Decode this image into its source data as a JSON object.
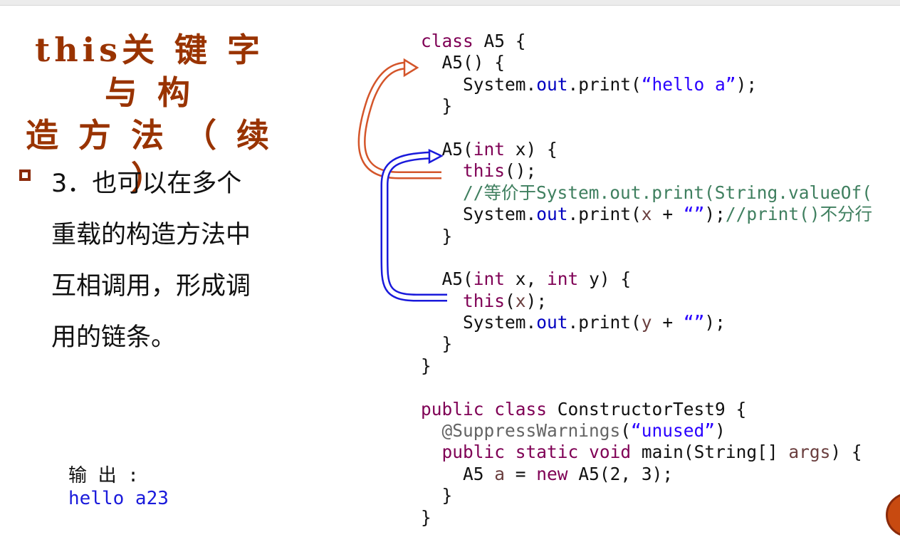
{
  "slide": {
    "title": "this关 键 字与 构\n造 方 法 （ 续 ）",
    "bullet_text": "3．也可以在多个\n重载的构造方法中\n互相调用，形成调\n用的链条。",
    "output_label": "输 出 :",
    "output_value": "hello a23"
  },
  "code_lines": [
    [
      {
        "t": "class",
        "c": "keyword"
      },
      {
        "t": " A5 {",
        "c": "plain"
      }
    ],
    [
      {
        "t": "  A5() {",
        "c": "plain"
      }
    ],
    [
      {
        "t": "    System.",
        "c": "plain"
      },
      {
        "t": "out",
        "c": "field"
      },
      {
        "t": ".print(",
        "c": "plain"
      },
      {
        "t": "“hello a”",
        "c": "string"
      },
      {
        "t": ");",
        "c": "plain"
      }
    ],
    [
      {
        "t": "  }",
        "c": "plain"
      }
    ],
    [
      {
        "t": "",
        "c": "plain"
      }
    ],
    [
      {
        "t": "  A5(",
        "c": "plain"
      },
      {
        "t": "int",
        "c": "keyword"
      },
      {
        "t": " x) {",
        "c": "plain"
      }
    ],
    [
      {
        "t": "    ",
        "c": "plain"
      },
      {
        "t": "this",
        "c": "keyword"
      },
      {
        "t": "();",
        "c": "plain"
      }
    ],
    [
      {
        "t": "    //等价于System.out.print(String.valueOf(",
        "c": "comment"
      }
    ],
    [
      {
        "t": "    System.",
        "c": "plain"
      },
      {
        "t": "out",
        "c": "field"
      },
      {
        "t": ".print(",
        "c": "plain"
      },
      {
        "t": "x",
        "c": "variable"
      },
      {
        "t": " + ",
        "c": "plain"
      },
      {
        "t": "“”",
        "c": "string"
      },
      {
        "t": ");",
        "c": "plain"
      },
      {
        "t": "//print()不分行",
        "c": "comment"
      }
    ],
    [
      {
        "t": "  }",
        "c": "plain"
      }
    ],
    [
      {
        "t": "",
        "c": "plain"
      }
    ],
    [
      {
        "t": "  A5(",
        "c": "plain"
      },
      {
        "t": "int",
        "c": "keyword"
      },
      {
        "t": " x, ",
        "c": "plain"
      },
      {
        "t": "int",
        "c": "keyword"
      },
      {
        "t": " y) {",
        "c": "plain"
      }
    ],
    [
      {
        "t": "    ",
        "c": "plain"
      },
      {
        "t": "this",
        "c": "keyword"
      },
      {
        "t": "(",
        "c": "plain"
      },
      {
        "t": "x",
        "c": "variable"
      },
      {
        "t": ");",
        "c": "plain"
      }
    ],
    [
      {
        "t": "    System.",
        "c": "plain"
      },
      {
        "t": "out",
        "c": "field"
      },
      {
        "t": ".print(",
        "c": "plain"
      },
      {
        "t": "y",
        "c": "variable"
      },
      {
        "t": " + ",
        "c": "plain"
      },
      {
        "t": "“”",
        "c": "string"
      },
      {
        "t": ");",
        "c": "plain"
      }
    ],
    [
      {
        "t": "  }",
        "c": "plain"
      }
    ],
    [
      {
        "t": "}",
        "c": "plain"
      }
    ],
    [
      {
        "t": "",
        "c": "plain"
      }
    ],
    [
      {
        "t": "public",
        "c": "keyword"
      },
      {
        "t": " ",
        "c": "plain"
      },
      {
        "t": "class",
        "c": "keyword"
      },
      {
        "t": " ConstructorTest9 {",
        "c": "plain"
      }
    ],
    [
      {
        "t": "  ",
        "c": "plain"
      },
      {
        "t": "@SuppressWarnings",
        "c": "annotation"
      },
      {
        "t": "(",
        "c": "plain"
      },
      {
        "t": "“unused”",
        "c": "string"
      },
      {
        "t": ")",
        "c": "plain"
      }
    ],
    [
      {
        "t": "  ",
        "c": "plain"
      },
      {
        "t": "public",
        "c": "keyword"
      },
      {
        "t": " ",
        "c": "plain"
      },
      {
        "t": "static",
        "c": "keyword"
      },
      {
        "t": " ",
        "c": "plain"
      },
      {
        "t": "void",
        "c": "keyword"
      },
      {
        "t": " main(String[] ",
        "c": "plain"
      },
      {
        "t": "args",
        "c": "variable"
      },
      {
        "t": ") {",
        "c": "plain"
      }
    ],
    [
      {
        "t": "    A5 ",
        "c": "plain"
      },
      {
        "t": "a",
        "c": "variable"
      },
      {
        "t": " = ",
        "c": "plain"
      },
      {
        "t": "new",
        "c": "keyword"
      },
      {
        "t": " A5(2, 3);",
        "c": "plain"
      }
    ],
    [
      {
        "t": "  }",
        "c": "plain"
      }
    ],
    [
      {
        "t": "}",
        "c": "plain"
      }
    ]
  ],
  "colors": {
    "title": "#993300",
    "keyword": "#7f0055",
    "field": "#0000c0",
    "string": "#2a00ff",
    "comment": "#3f7f5f",
    "arrow_orange": "#d4552a",
    "arrow_blue": "#1a1adb"
  }
}
